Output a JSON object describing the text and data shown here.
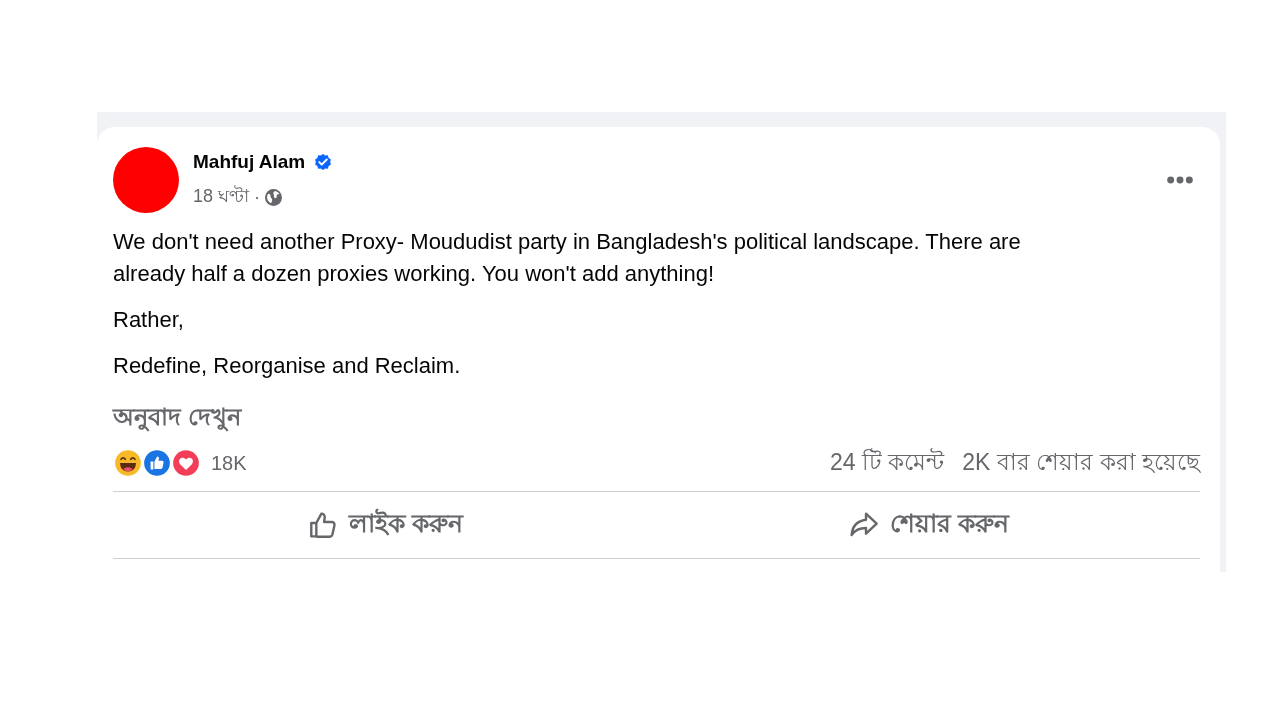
{
  "post": {
    "author": {
      "name": "Mahfuj Alam",
      "verified": true
    },
    "time": "18 ঘণ্টা",
    "separator": "·",
    "paragraphs": [
      "We don't need another Proxy- Moududist party in Bangladesh's political landscape. There are already half a dozen proxies working. You won't add anything!",
      "Rather,",
      "Redefine, Reorganise and Reclaim."
    ],
    "see_translation": "অনুবাদ দেখুন",
    "reaction_count": "18K",
    "comments": "24 টি কমেন্ট",
    "shares": "2K বার শেয়ার করা হয়েছে",
    "actions": [
      {
        "kind": "like",
        "label": "লাইক করুন"
      },
      {
        "kind": "share",
        "label": "শেয়ার করুন"
      }
    ]
  }
}
